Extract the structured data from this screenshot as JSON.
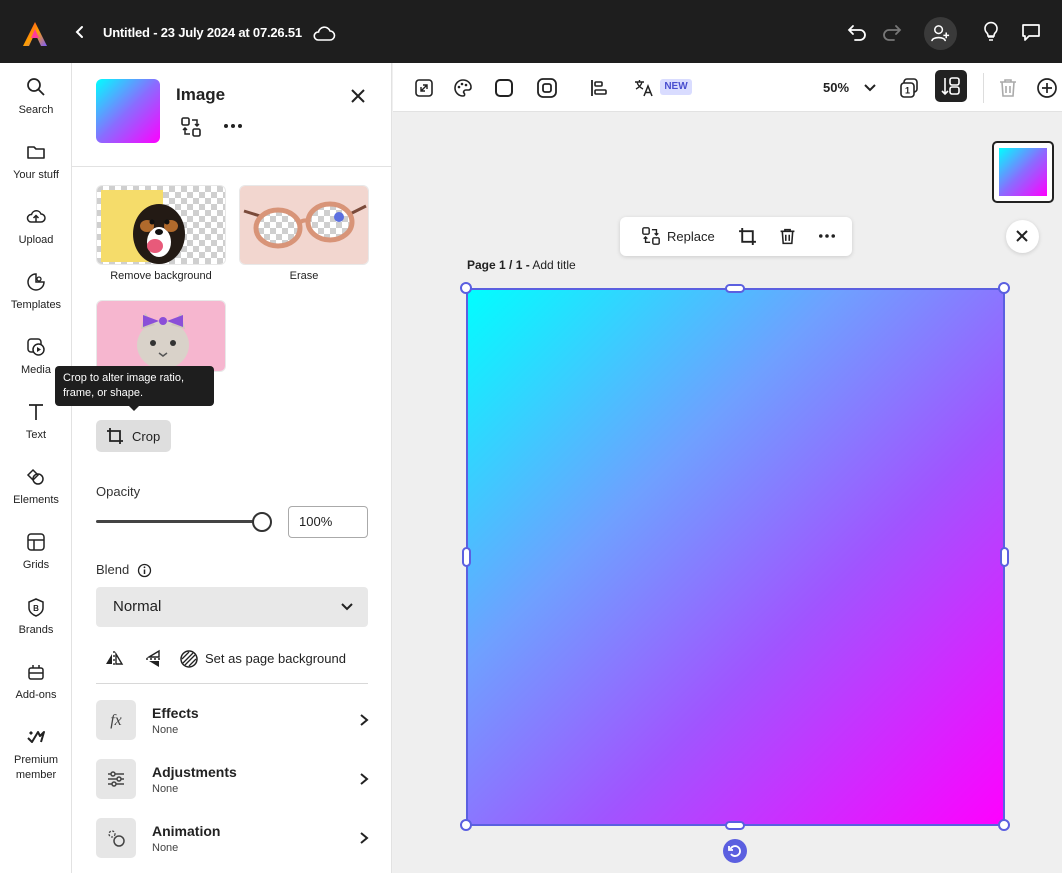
{
  "app": {
    "doc_title": "Untitled - 23 July 2024 at 07.26.51"
  },
  "rail": {
    "items": [
      {
        "label": "Search",
        "icon": "search-icon"
      },
      {
        "label": "Your stuff",
        "icon": "folder-icon"
      },
      {
        "label": "Upload",
        "icon": "upload-icon"
      },
      {
        "label": "Templates",
        "icon": "templates-icon"
      },
      {
        "label": "Media",
        "icon": "media-icon"
      },
      {
        "label": "Text",
        "icon": "text-icon"
      },
      {
        "label": "Elements",
        "icon": "elements-icon"
      },
      {
        "label": "Grids",
        "icon": "grids-icon"
      },
      {
        "label": "Brands",
        "icon": "brands-icon"
      },
      {
        "label": "Add-ons",
        "icon": "addons-icon"
      },
      {
        "label": "Premium member",
        "label_line1": "Premium",
        "label_line2": "member",
        "icon": "premium-icon"
      }
    ]
  },
  "panel": {
    "title": "Image",
    "quick_actions": [
      {
        "label": "Remove background"
      },
      {
        "label": "Erase"
      }
    ],
    "tooltip": "Crop to alter image ratio, frame, or shape.",
    "crop_label": "Crop",
    "opacity_label": "Opacity",
    "opacity_value": "100%",
    "opacity_level": 1.0,
    "blend_label": "Blend",
    "blend_value": "Normal",
    "set_bg_label": "Set as page background",
    "rows": [
      {
        "title": "Effects",
        "sub": "None"
      },
      {
        "title": "Adjustments",
        "sub": "None"
      },
      {
        "title": "Animation",
        "sub": "None"
      }
    ]
  },
  "toolbar": {
    "new_badge": "NEW",
    "zoom": "50%"
  },
  "canvas": {
    "replace_label": "Replace",
    "page_label": "Page 1 / 1 -",
    "page_title_placeholder": "Add title"
  },
  "colors": {
    "accent": "#5b5fe0",
    "gradient_start": "#00ffff",
    "gradient_end": "#ff00ff"
  }
}
